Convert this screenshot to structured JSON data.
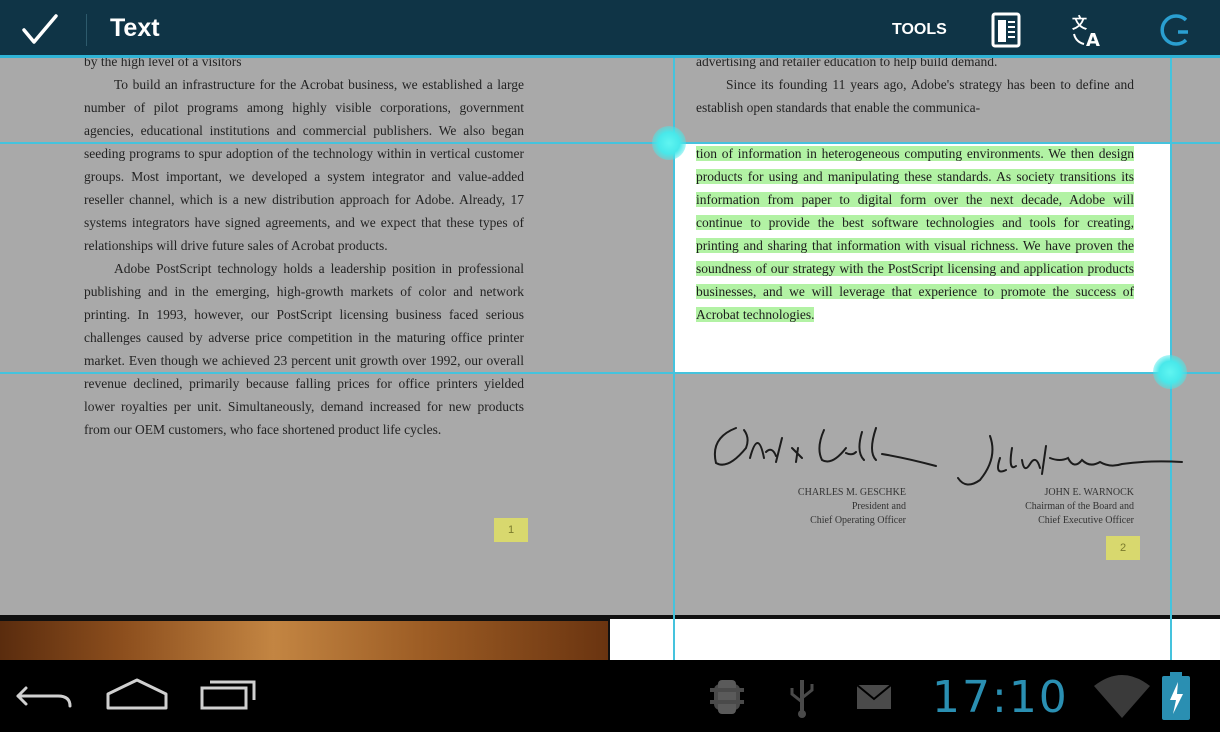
{
  "action_bar": {
    "done_icon": "checkmark-icon",
    "title": "Text",
    "tools_label": "TOOLS",
    "icons": [
      "document-icon",
      "translate-icon",
      "search-icon"
    ]
  },
  "document": {
    "left_column": {
      "partial_top_line": "by the high level of a visitors",
      "paragraphs": [
        "To build an infrastructure for the Acrobat business, we established a large number of pilot programs among highly visible corporations, government agencies, educational institutions and commercial publishers. We also began seeding programs to spur adoption of the technology within in vertical customer groups. Most important, we developed a system integrator and value-added reseller channel, which is a new distribution approach for Adobe. Already, 17 systems integrators have signed agreements, and we expect that these types of relationships will drive future sales of Acrobat products.",
        "Adobe PostScript technology holds a leadership position in professional publishing and in the emerging, high-growth markets of color and network printing. In 1993, however, our PostScript licensing business faced serious challenges caused by adverse price competition in the maturing office printer market. Even though we achieved 23 percent unit growth over 1992, our overall revenue declined, primarily because falling prices for office printers yielded lower royalties per unit. Simultaneously, demand increased for new products from our OEM customers, who face shortened product life cycles."
      ],
      "page_mark": "1"
    },
    "right_column": {
      "before_selection": [
        "advertising and retailer education to help build demand.",
        "Since its founding 11 years ago, Adobe's strategy has been to define and establish open standards that enable the communica-"
      ],
      "selected_text": "tion of information in heterogeneous computing environments. We then design products for using and manipulating these standards. As society transitions its information from paper to digital form over the next decade, Adobe will continue to provide the best software technologies and tools for creating, printing and sharing that information with visual richness. We have proven the soundness of our strategy with the PostScript licensing and application products businesses, and we will leverage that experience to promote the success of Acrobat technologies.",
      "signatures": [
        {
          "name": "CHARLES M. GESCHKE",
          "title_lines": [
            "President and",
            "Chief Operating Officer"
          ]
        },
        {
          "name": "JOHN E. WARNOCK",
          "title_lines": [
            "Chairman of the Board and",
            "Chief Executive Officer"
          ]
        }
      ],
      "page_mark": "2"
    }
  },
  "system_bar": {
    "nav_icons": [
      "back-icon",
      "home-icon",
      "recent-apps-icon"
    ],
    "status_icons": [
      "android-debug-icon",
      "usb-icon",
      "mail-icon",
      "wifi-icon",
      "battery-charging-icon"
    ],
    "clock": "17:10"
  },
  "colors": {
    "action_bar": "#0f3446",
    "accent": "#2fb3d6",
    "highlight": "#b2f2a4",
    "handle": "#48e8ea",
    "clock": "#2a8fb2"
  }
}
